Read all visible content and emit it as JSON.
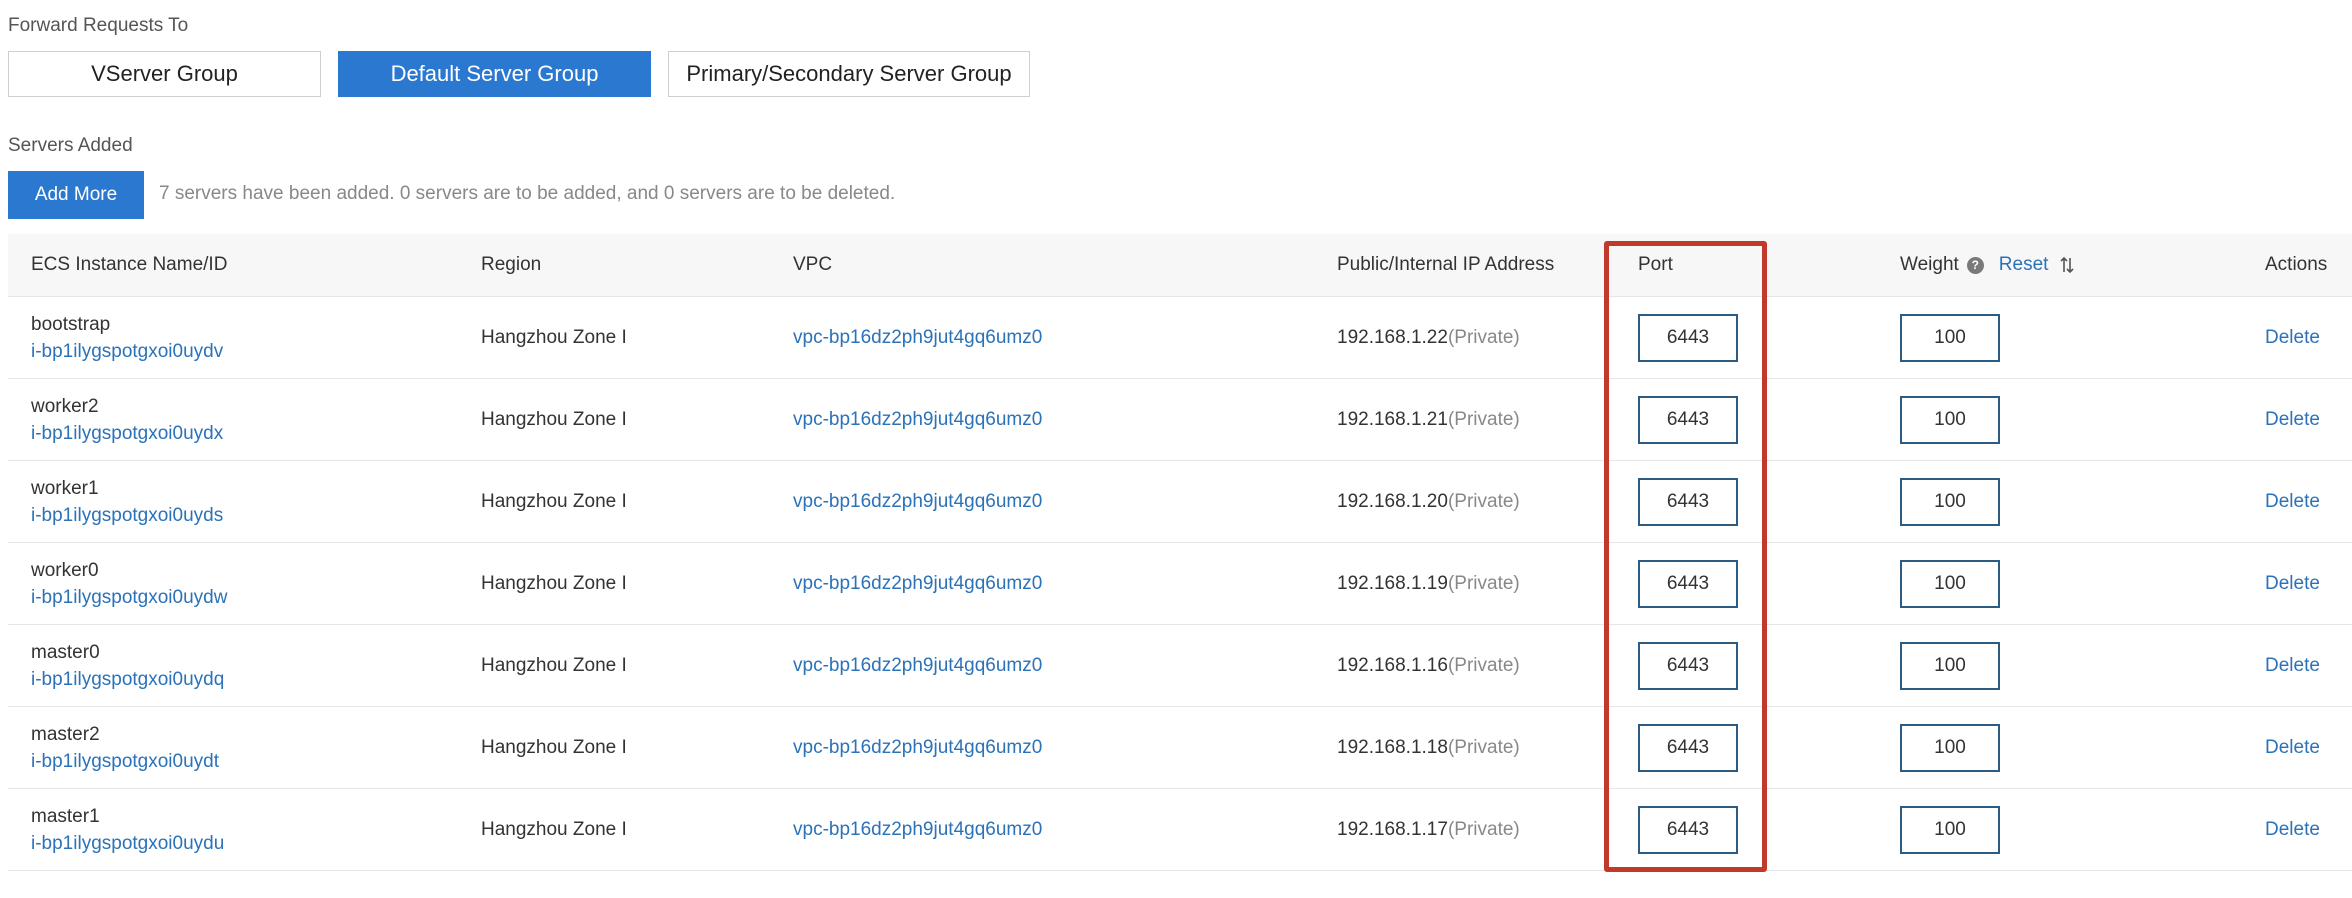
{
  "forward": {
    "label": "Forward Requests To",
    "options": [
      "VServer Group",
      "Default Server Group",
      "Primary/Secondary Server Group"
    ],
    "selected": "Default Server Group"
  },
  "servers": {
    "label": "Servers Added",
    "add_more_label": "Add More",
    "summary": "7 servers have been added. 0 servers are to be added, and 0 servers are to be deleted."
  },
  "table": {
    "headers": {
      "name": "ECS Instance Name/ID",
      "region": "Region",
      "vpc": "VPC",
      "ip": "Public/Internal IP Address",
      "port": "Port",
      "weight": "Weight",
      "reset": "Reset",
      "actions": "Actions"
    },
    "rows": [
      {
        "name": "bootstrap",
        "id": "i-bp1ilygspotgxoi0uydv",
        "region": "Hangzhou Zone I",
        "vpc": "vpc-bp16dz2ph9jut4gq6umz0",
        "ip": "192.168.1.22",
        "ip_type": "(Private)",
        "port": "6443",
        "weight": "100",
        "action": "Delete"
      },
      {
        "name": "worker2",
        "id": "i-bp1ilygspotgxoi0uydx",
        "region": "Hangzhou Zone I",
        "vpc": "vpc-bp16dz2ph9jut4gq6umz0",
        "ip": "192.168.1.21",
        "ip_type": "(Private)",
        "port": "6443",
        "weight": "100",
        "action": "Delete"
      },
      {
        "name": "worker1",
        "id": "i-bp1ilygspotgxoi0uyds",
        "region": "Hangzhou Zone I",
        "vpc": "vpc-bp16dz2ph9jut4gq6umz0",
        "ip": "192.168.1.20",
        "ip_type": "(Private)",
        "port": "6443",
        "weight": "100",
        "action": "Delete"
      },
      {
        "name": "worker0",
        "id": "i-bp1ilygspotgxoi0uydw",
        "region": "Hangzhou Zone I",
        "vpc": "vpc-bp16dz2ph9jut4gq6umz0",
        "ip": "192.168.1.19",
        "ip_type": "(Private)",
        "port": "6443",
        "weight": "100",
        "action": "Delete"
      },
      {
        "name": "master0",
        "id": "i-bp1ilygspotgxoi0uydq",
        "region": "Hangzhou Zone I",
        "vpc": "vpc-bp16dz2ph9jut4gq6umz0",
        "ip": "192.168.1.16",
        "ip_type": "(Private)",
        "port": "6443",
        "weight": "100",
        "action": "Delete"
      },
      {
        "name": "master2",
        "id": "i-bp1ilygspotgxoi0uydt",
        "region": "Hangzhou Zone I",
        "vpc": "vpc-bp16dz2ph9jut4gq6umz0",
        "ip": "192.168.1.18",
        "ip_type": "(Private)",
        "port": "6443",
        "weight": "100",
        "action": "Delete"
      },
      {
        "name": "master1",
        "id": "i-bp1ilygspotgxoi0uydu",
        "region": "Hangzhou Zone I",
        "vpc": "vpc-bp16dz2ph9jut4gq6umz0",
        "ip": "192.168.1.17",
        "ip_type": "(Private)",
        "port": "6443",
        "weight": "100",
        "action": "Delete"
      }
    ]
  },
  "icons": {
    "help": "question-circle-icon",
    "sort": "sort-arrows-icon"
  },
  "colors": {
    "primary": "#2b78d0",
    "link": "#2b72b8",
    "highlight": "#c0392b",
    "input_border": "#2c5c84"
  }
}
